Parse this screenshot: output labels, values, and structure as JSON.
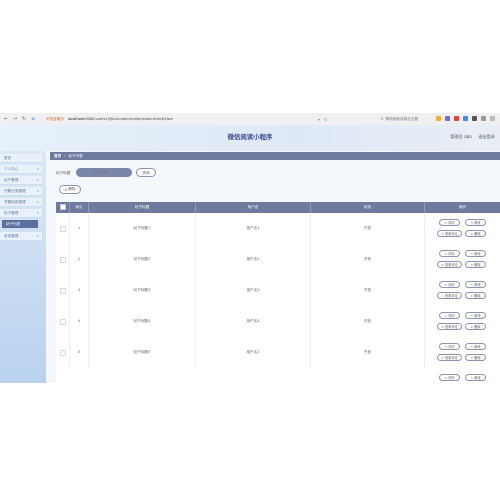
{
  "browser": {
    "security_text": "不安全暗示",
    "url_host": "localhost",
    "url_rest": ":8080/users1/jfjlcxlu/admin/dist/index.html#/tiezi",
    "search_placeholder": "帮助搜索该网页主题",
    "nav_icons": [
      "back-icon",
      "forward-icon",
      "reload-icon",
      "home-icon"
    ]
  },
  "header": {
    "title": "微信阅读小程序",
    "user_label": "管理员 abo",
    "logout_label": "退出登录"
  },
  "sidebar": {
    "items": [
      {
        "label": "首页",
        "has_chevron": false
      },
      {
        "label": "个人中心",
        "has_chevron": true
      },
      {
        "label": "用户管理",
        "has_chevron": true
      },
      {
        "label": "书籍分类管理",
        "has_chevron": true
      },
      {
        "label": "书籍信息管理",
        "has_chevron": true
      },
      {
        "label": "帖子管理",
        "has_chevron": true
      },
      {
        "label": "帖子列表",
        "has_chevron": false,
        "active": true
      },
      {
        "label": "系统管理",
        "has_chevron": true
      }
    ]
  },
  "breadcrumb": {
    "home": "首页",
    "current": "帖子列表"
  },
  "search": {
    "label": "帖子标题",
    "placeholder": "帖子标题",
    "query_label": "查询"
  },
  "toolbar": {
    "delete_label": "删除"
  },
  "table": {
    "columns": [
      "",
      "索引",
      "帖子标题",
      "用户名",
      "状态",
      "操作"
    ],
    "rows": [
      {
        "index": "1",
        "title": "帖子标题1",
        "user": "用户名1",
        "status": "开放"
      },
      {
        "index": "2",
        "title": "帖子标题2",
        "user": "用户名2",
        "status": "开放"
      },
      {
        "index": "3",
        "title": "帖子标题3",
        "user": "用户名3",
        "status": "开放"
      },
      {
        "index": "4",
        "title": "帖子标题4",
        "user": "用户名4",
        "status": "开放"
      },
      {
        "index": "5",
        "title": "帖子标题5",
        "user": "用户名5",
        "status": "开放"
      }
    ],
    "actions": {
      "detail": "详情",
      "edit": "修改",
      "view_comments": "查看评论",
      "delete": "删除"
    }
  },
  "colors": {
    "primary": "#6e7a9e",
    "title": "#3c4c8c",
    "active_menu": "#5b6fa0"
  }
}
